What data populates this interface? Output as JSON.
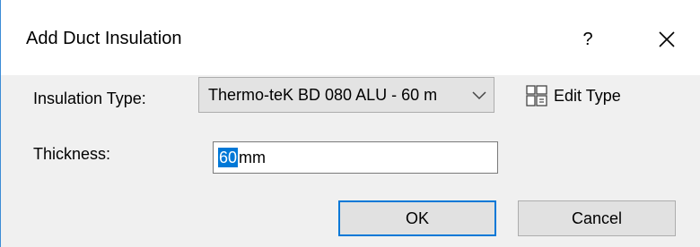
{
  "dialog": {
    "title": "Add Duct Insulation",
    "help_label": "?",
    "close_icon": "close-icon"
  },
  "insulation_type": {
    "label": "Insulation Type:",
    "value": "Thermo-teK BD 080 ALU - 60 m",
    "dropdown_icon": "chevron-down-icon"
  },
  "edit_type": {
    "label": "Edit Type",
    "icon": "edit-type-icon"
  },
  "thickness": {
    "label": "Thickness:",
    "value": "60",
    "unit": "mm"
  },
  "buttons": {
    "ok": "OK",
    "cancel": "Cancel"
  },
  "colors": {
    "accent": "#0078d7",
    "window_border": "#3c8cd6",
    "dialog_bg": "#f0f0f0"
  }
}
